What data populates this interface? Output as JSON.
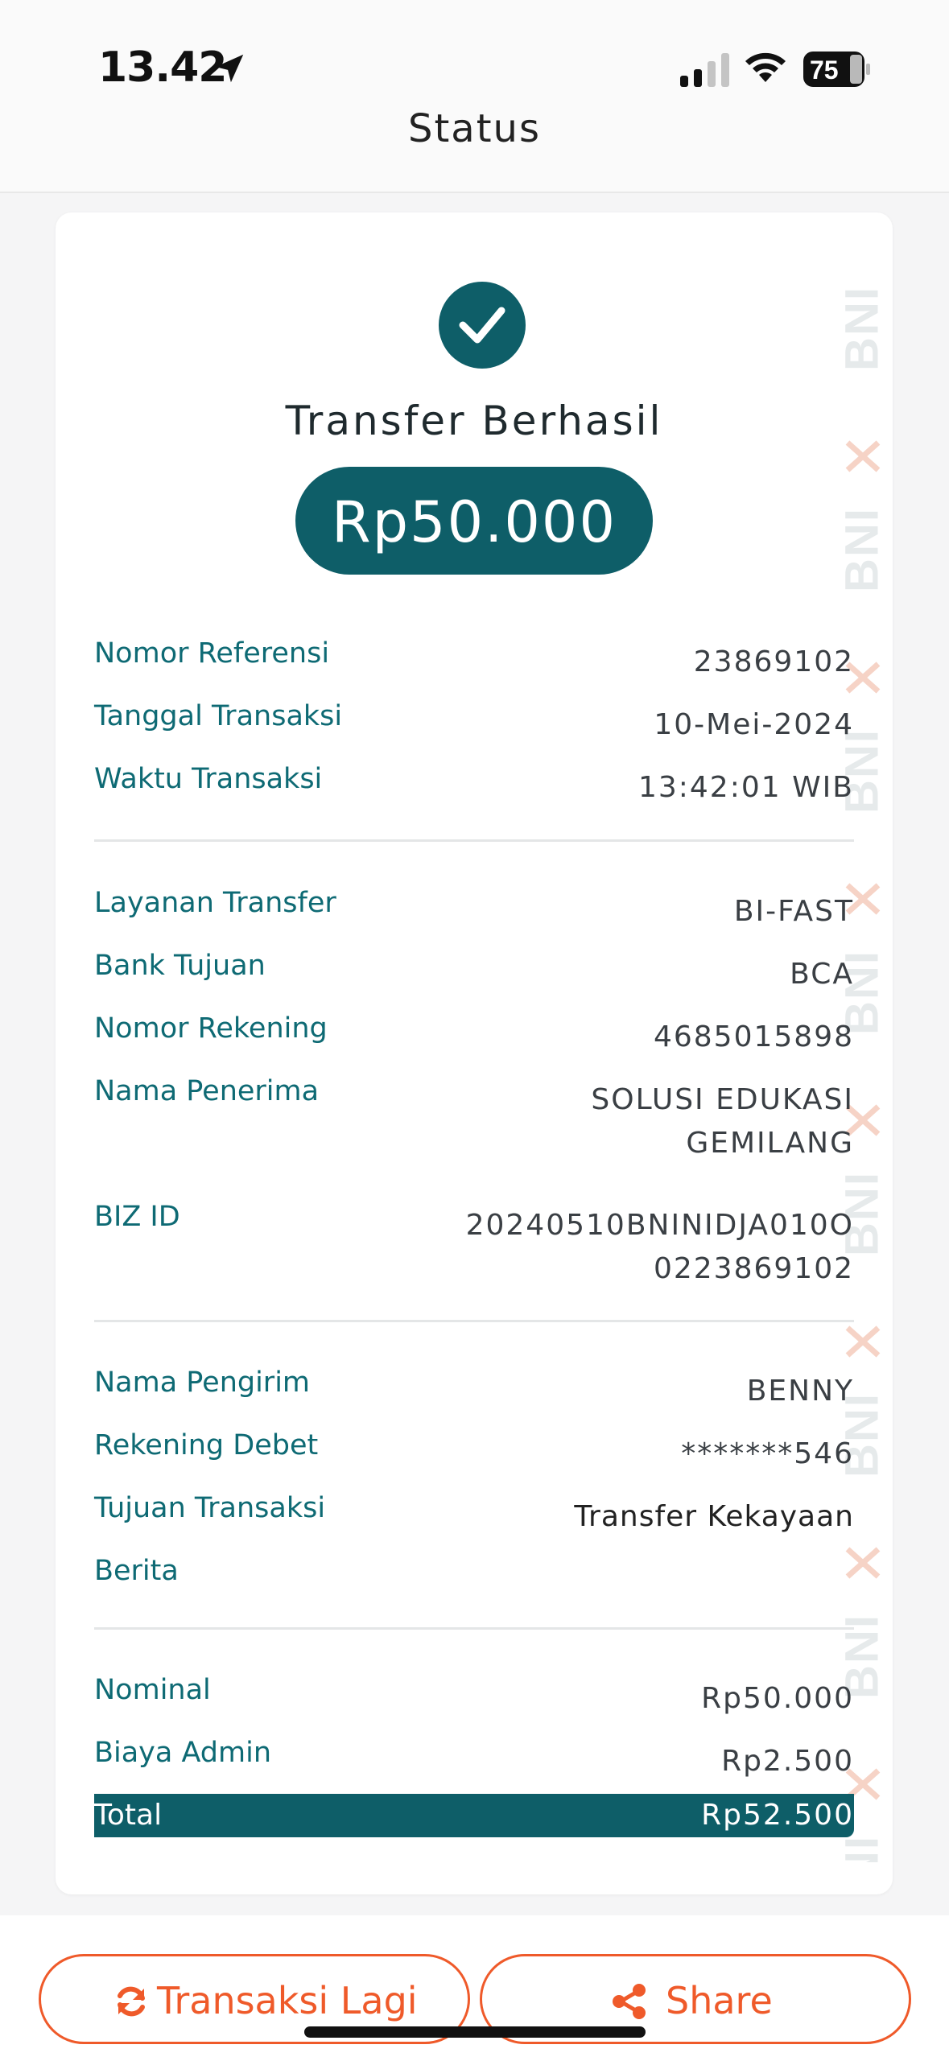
{
  "status_bar": {
    "time": "13.42",
    "battery": "75"
  },
  "header": {
    "title": "Status"
  },
  "receipt": {
    "status_title": "Transfer Berhasil",
    "amount": "Rp50.000",
    "watermark": "BNI",
    "section1": [
      {
        "label": "Nomor Referensi",
        "value": [
          "23869102"
        ]
      },
      {
        "label": "Tanggal Transaksi",
        "value": [
          "10-Mei-2024"
        ]
      },
      {
        "label": "Waktu Transaksi",
        "value": [
          "13:42:01 WIB"
        ]
      }
    ],
    "section2": [
      {
        "label": "Layanan Transfer",
        "value": [
          "BI-FAST"
        ]
      },
      {
        "label": "Bank Tujuan",
        "value": [
          "BCA"
        ]
      },
      {
        "label": "Nomor Rekening",
        "value": [
          "4685015898"
        ]
      },
      {
        "label": "Nama Penerima",
        "value": [
          "SOLUSI EDUKASI",
          "GEMILANG"
        ]
      },
      {
        "label": "BIZ ID",
        "value": [
          "20240510BNINIDJA010O",
          "0223869102"
        ]
      }
    ],
    "section3": [
      {
        "label": "Nama Pengirim",
        "value": [
          "BENNY"
        ]
      },
      {
        "label": "Rekening Debet",
        "value": [
          "*******546"
        ]
      },
      {
        "label": "Tujuan Transaksi",
        "value": [
          "Transfer Kekayaan"
        ]
      },
      {
        "label": "Berita",
        "value": [
          ""
        ]
      }
    ],
    "section4": [
      {
        "label": "Nominal",
        "value": [
          "Rp50.000"
        ]
      },
      {
        "label": "Biaya Admin",
        "value": [
          "Rp2.500"
        ]
      }
    ],
    "total": {
      "label": "Total",
      "value": "Rp52.500"
    }
  },
  "actions": {
    "again_label": "Transaksi Lagi",
    "share_label": "Share"
  },
  "colors": {
    "primary": "#0e5e68",
    "label": "#0e6a74",
    "accent": "#ef5a2a"
  },
  "icons": {
    "status": "check-icon",
    "again": "refresh-icon",
    "share": "share-icon",
    "location": "location-arrow-icon"
  }
}
